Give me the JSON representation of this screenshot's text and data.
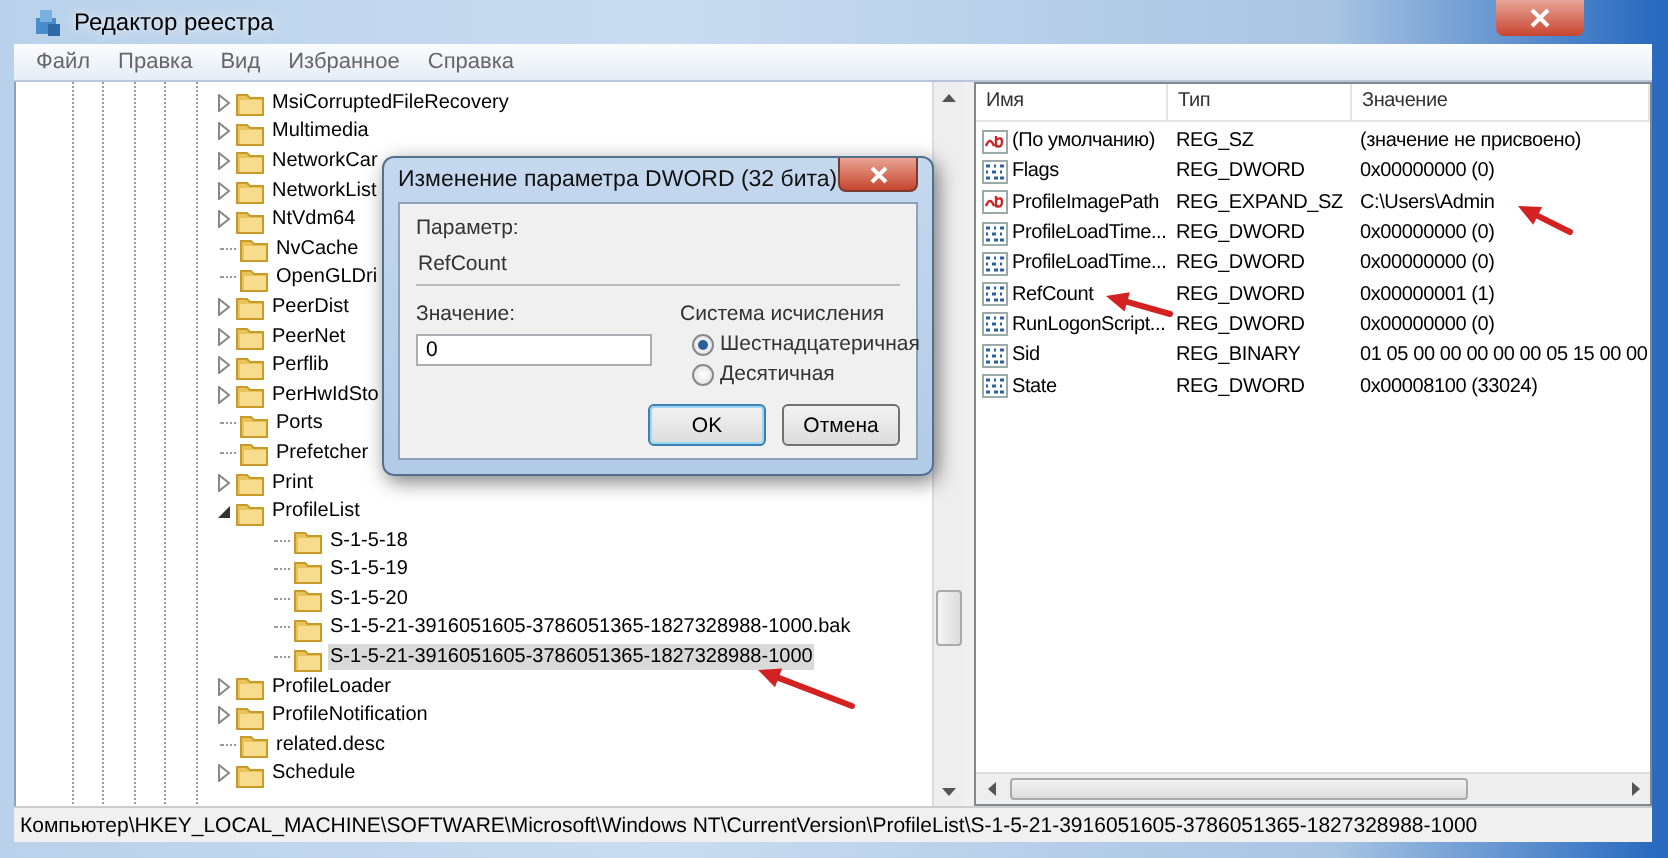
{
  "window": {
    "title": "Редактор реестра"
  },
  "menu": [
    "Файл",
    "Правка",
    "Вид",
    "Избранное",
    "Справка"
  ],
  "tree": {
    "items": [
      {
        "label": "MsiCorruptedFileRecovery",
        "expandable": true,
        "expanded": false,
        "selected": false
      },
      {
        "label": "Multimedia",
        "expandable": true,
        "expanded": false,
        "selected": false
      },
      {
        "label": "NetworkCar",
        "expandable": true,
        "expanded": false,
        "selected": false
      },
      {
        "label": "NetworkList",
        "expandable": true,
        "expanded": false,
        "selected": false
      },
      {
        "label": "NtVdm64",
        "expandable": true,
        "expanded": false,
        "selected": false
      },
      {
        "label": "NvCache",
        "expandable": false,
        "expanded": false,
        "selected": false
      },
      {
        "label": "OpenGLDri",
        "expandable": false,
        "expanded": false,
        "selected": false
      },
      {
        "label": "PeerDist",
        "expandable": true,
        "expanded": false,
        "selected": false
      },
      {
        "label": "PeerNet",
        "expandable": true,
        "expanded": false,
        "selected": false
      },
      {
        "label": "Perflib",
        "expandable": true,
        "expanded": false,
        "selected": false
      },
      {
        "label": "PerHwIdSto",
        "expandable": true,
        "expanded": false,
        "selected": false
      },
      {
        "label": "Ports",
        "expandable": false,
        "expanded": false,
        "selected": false
      },
      {
        "label": "Prefetcher",
        "expandable": false,
        "expanded": false,
        "selected": false
      },
      {
        "label": "Print",
        "expandable": true,
        "expanded": false,
        "selected": false
      },
      {
        "label": "ProfileList",
        "expandable": true,
        "expanded": true,
        "selected": false,
        "children": [
          {
            "label": "S-1-5-18",
            "expandable": false,
            "expanded": false,
            "selected": false
          },
          {
            "label": "S-1-5-19",
            "expandable": false,
            "expanded": false,
            "selected": false
          },
          {
            "label": "S-1-5-20",
            "expandable": false,
            "expanded": false,
            "selected": false
          },
          {
            "label": "S-1-5-21-3916051605-3786051365-1827328988-1000.bak",
            "expandable": false,
            "expanded": false,
            "selected": false
          },
          {
            "label": "S-1-5-21-3916051605-3786051365-1827328988-1000",
            "expandable": false,
            "expanded": false,
            "selected": true
          }
        ]
      },
      {
        "label": "ProfileLoader",
        "expandable": true,
        "expanded": false,
        "selected": false
      },
      {
        "label": "ProfileNotification",
        "expandable": true,
        "expanded": false,
        "selected": false
      },
      {
        "label": "related.desc",
        "expandable": false,
        "expanded": false,
        "selected": false
      },
      {
        "label": "Schedule",
        "expandable": true,
        "expanded": false,
        "selected": false
      }
    ]
  },
  "values": {
    "columns": [
      "Имя",
      "Тип",
      "Значение"
    ],
    "rows": [
      {
        "kind": "string",
        "name": "(По умолчанию)",
        "type": "REG_SZ",
        "data": "(значение не присвоено)"
      },
      {
        "kind": "binary",
        "name": "Flags",
        "type": "REG_DWORD",
        "data": "0x00000000 (0)"
      },
      {
        "kind": "string",
        "name": "ProfileImagePath",
        "type": "REG_EXPAND_SZ",
        "data": "C:\\Users\\Admin"
      },
      {
        "kind": "binary",
        "name": "ProfileLoadTime...",
        "type": "REG_DWORD",
        "data": "0x00000000 (0)"
      },
      {
        "kind": "binary",
        "name": "ProfileLoadTime...",
        "type": "REG_DWORD",
        "data": "0x00000000 (0)"
      },
      {
        "kind": "binary",
        "name": "RefCount",
        "type": "REG_DWORD",
        "data": "0x00000001 (1)"
      },
      {
        "kind": "binary",
        "name": "RunLogonScript...",
        "type": "REG_DWORD",
        "data": "0x00000000 (0)"
      },
      {
        "kind": "binary",
        "name": "Sid",
        "type": "REG_BINARY",
        "data": "01 05 00 00 00 00 00 05 15 00 00"
      },
      {
        "kind": "binary",
        "name": "State",
        "type": "REG_DWORD",
        "data": "0x00008100 (33024)"
      }
    ]
  },
  "dialog": {
    "title": "Изменение параметра DWORD (32 бита)",
    "parameter_label": "Параметр:",
    "parameter_value": "RefCount",
    "value_label": "Значение:",
    "value": "0",
    "base_group": {
      "title": "Система исчисления",
      "options": [
        {
          "label": "Шестнадцатеричная",
          "selected": true
        },
        {
          "label": "Десятичная",
          "selected": false
        }
      ]
    },
    "buttons": [
      {
        "label": "OK",
        "default": true
      },
      {
        "label": "Отмена",
        "default": false
      }
    ]
  },
  "status_bar": "Компьютер\\HKEY_LOCAL_MACHINE\\SOFTWARE\\Microsoft\\Windows NT\\CurrentVersion\\ProfileList\\S-1-5-21-3916051605-3786051365-1827328988-1000"
}
